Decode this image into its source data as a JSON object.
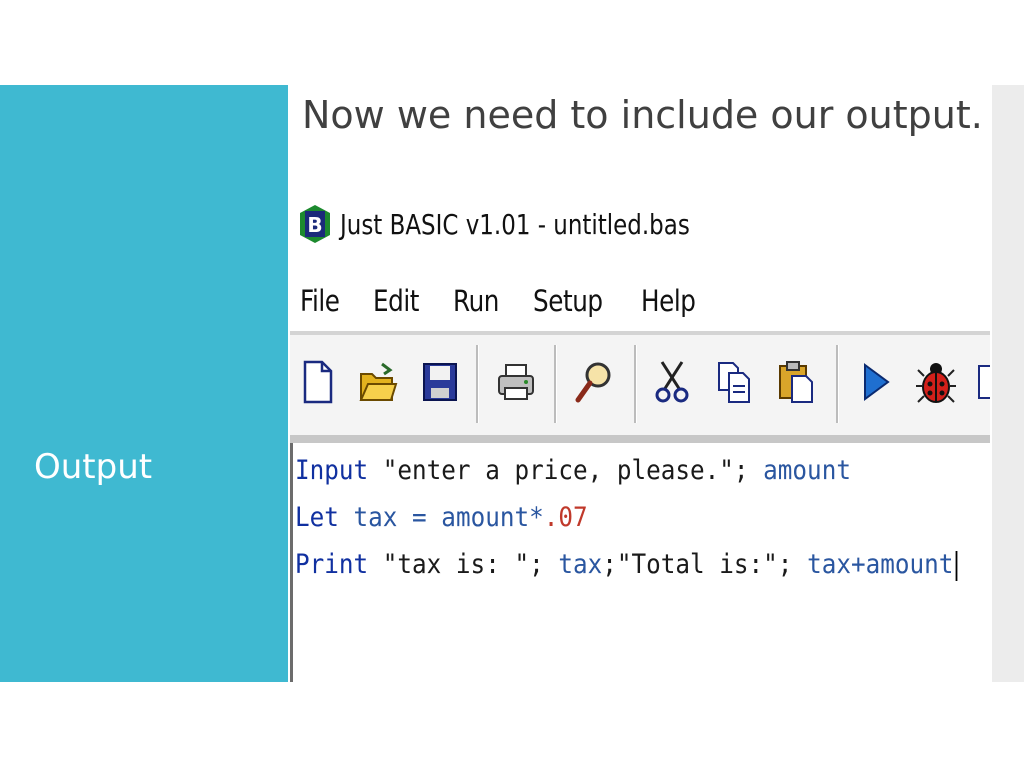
{
  "slide": {
    "sidebar_title": "Output",
    "heading": "Now we need to include our output."
  },
  "window": {
    "title": "Just BASIC v1.01 - untitled.bas",
    "icon_letter": "B",
    "menu": [
      "File",
      "Edit",
      "Run",
      "Setup",
      "Help"
    ],
    "toolbar_icons": [
      "new-file-icon",
      "open-folder-icon",
      "save-icon",
      "print-icon",
      "find-icon",
      "cut-icon",
      "copy-icon",
      "paste-icon",
      "run-icon",
      "debug-icon"
    ]
  },
  "code": {
    "line1": {
      "kw": "Input",
      "str": " \"enter a price, please.\"; ",
      "var": "amount"
    },
    "line2": {
      "kw": "Let",
      "var": " tax = amount*",
      "num": ".07"
    },
    "line3": {
      "kw": "Print",
      "str": " \"tax is: \"; ",
      "var1": "tax",
      "str2": ";\"Total is:\"; ",
      "var2": "tax+amount"
    }
  },
  "colors": {
    "sidebar": "#3fb9d1",
    "keyword": "#1030a0",
    "variable": "#2a56a0",
    "number": "#c0392b"
  }
}
